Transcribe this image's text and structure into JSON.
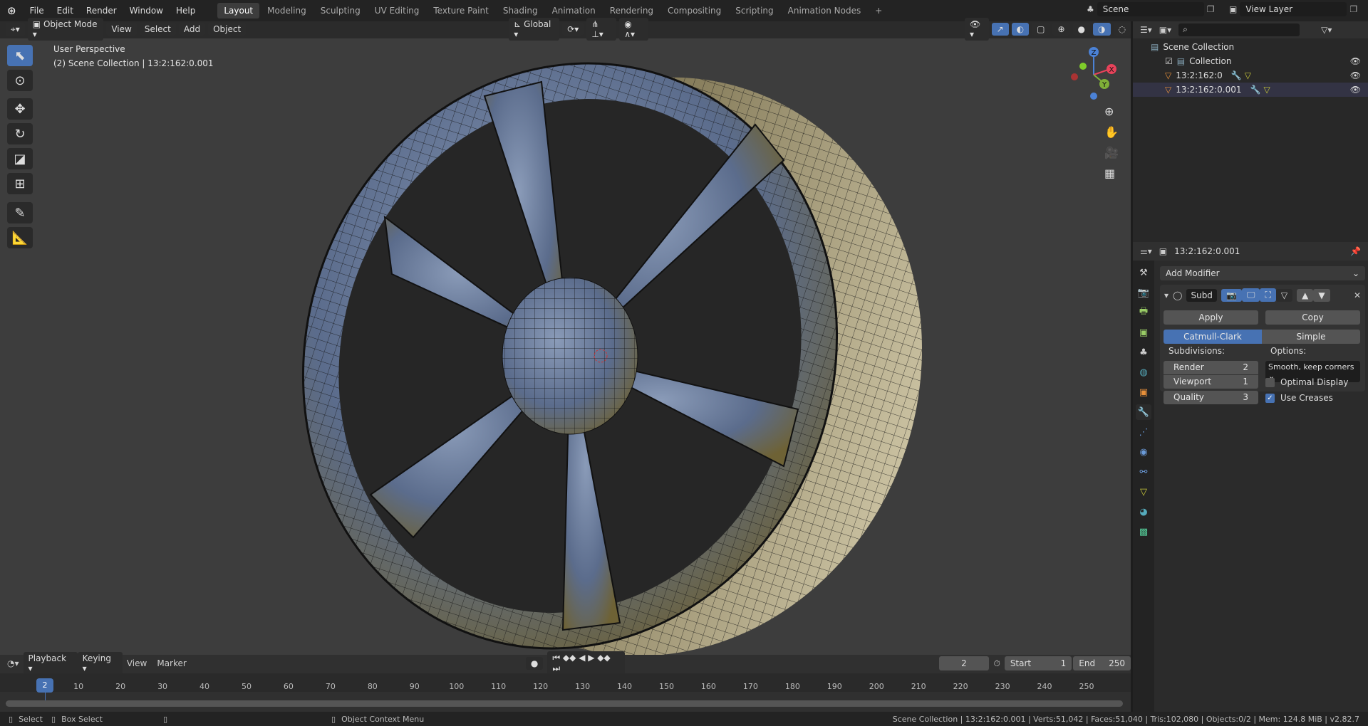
{
  "menu": {
    "items": [
      "File",
      "Edit",
      "Render",
      "Window",
      "Help"
    ]
  },
  "workspaces": [
    "Layout",
    "Modeling",
    "Sculpting",
    "UV Editing",
    "Texture Paint",
    "Shading",
    "Animation",
    "Rendering",
    "Compositing",
    "Scripting",
    "Animation Nodes"
  ],
  "active_workspace": "Layout",
  "scene": {
    "name": "Scene",
    "view_layer": "View Layer"
  },
  "viewport": {
    "mode": "Object Mode",
    "menus": [
      "View",
      "Select",
      "Add",
      "Object"
    ],
    "orientation": "Global",
    "overlay_title": "User Perspective",
    "overlay_subtitle": "(2) Scene Collection | 13:2:162:0.001",
    "gizmo": {
      "x": "X",
      "y": "Y",
      "z": "Z"
    }
  },
  "outliner": {
    "root": "Scene Collection",
    "items": [
      {
        "name": "Collection"
      },
      {
        "name": "13:2:162:0"
      },
      {
        "name": "13:2:162:0.001"
      }
    ]
  },
  "properties": {
    "object": "13:2:162:0.001",
    "add_modifier": "Add Modifier",
    "modifier_name": "Subd",
    "apply": "Apply",
    "copy": "Copy",
    "catmull": "Catmull-Clark",
    "simple": "Simple",
    "subdivisions_label": "Subdivisions:",
    "options_label": "Options:",
    "render_label": "Render",
    "render_value": "2",
    "viewport_label": "Viewport",
    "viewport_value": "1",
    "quality_label": "Quality",
    "quality_value": "3",
    "uv_smooth": "Smooth, keep corners",
    "optimal_display": "Optimal Display",
    "optimal_checked": false,
    "use_creases": "Use Creases",
    "creases_checked": true
  },
  "timeline": {
    "menus": [
      "Playback",
      "Keying",
      "View",
      "Marker"
    ],
    "current_frame": "2",
    "start_label": "Start",
    "start": "1",
    "end_label": "End",
    "end": "250",
    "ticks": [
      "10",
      "20",
      "30",
      "40",
      "50",
      "60",
      "70",
      "80",
      "90",
      "100",
      "110",
      "120",
      "130",
      "140",
      "150",
      "160",
      "170",
      "180",
      "190",
      "200",
      "210",
      "220",
      "230",
      "240",
      "250"
    ]
  },
  "status": {
    "select": "Select",
    "box_select": "Box Select",
    "context_menu": "Object Context Menu",
    "info": "Scene Collection | 13:2:162:0.001 | Verts:51,042 | Faces:51,040 | Tris:102,080 | Objects:0/2 | Mem: 124.8 MiB | v2.82.7"
  }
}
